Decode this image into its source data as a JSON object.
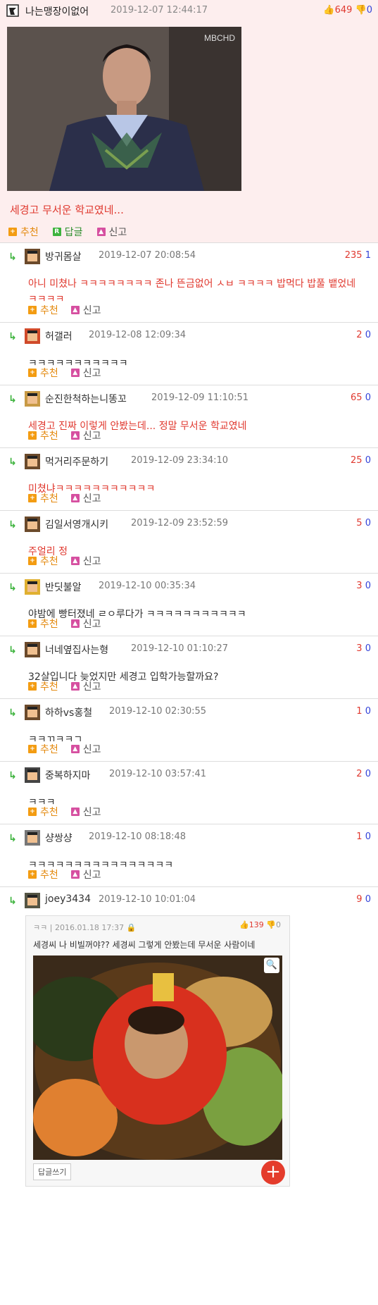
{
  "post": {
    "nick": "나는맹장이없어",
    "date": "2019-12-07 12:44:17",
    "up": "649",
    "down": "0",
    "title": "세경고 무서운 학교였네...",
    "image_overlay": "MBCHD",
    "actions": {
      "recommend": "추천",
      "reply": "답글",
      "report": "신고"
    }
  },
  "comments": [
    {
      "nick": "방귀몸살",
      "date": "2019-12-07 20:08:54",
      "up": "235",
      "down": "1",
      "text": "아니 미쳤나 ㅋㅋㅋㅋㅋㅋㅋㅋ 존나 뜬금없어 ㅅㅂ ㅋㅋㅋㅋ 밥먹다 밥풀 뱉었네 ㅋㅋㅋㅋ",
      "red": true
    },
    {
      "nick": "허갤러",
      "date": "2019-12-08 12:09:34",
      "up": "2",
      "down": "0",
      "text": "ㅋㅋㅋㅋㅋㅋㅋㅋㅋㅋㅋ",
      "red": false
    },
    {
      "nick": "순진한척하는니똥꼬",
      "date": "2019-12-09 11:10:51",
      "up": "65",
      "down": "0",
      "text": "세경고 진짜 이렇게 안봤는데... 정말 무서운 학교였네",
      "red": true
    },
    {
      "nick": "먹거리주문하기",
      "date": "2019-12-09 23:34:10",
      "up": "25",
      "down": "0",
      "text": "미쳤냐ㅋㅋㅋㅋㅋㅋㅋㅋㅋㅋㅋ",
      "red": true
    },
    {
      "nick": "김일서영개시키",
      "date": "2019-12-09 23:52:59",
      "up": "5",
      "down": "0",
      "text": "주얼리 정",
      "red": true
    },
    {
      "nick": "반딧불알",
      "date": "2019-12-10 00:35:34",
      "up": "3",
      "down": "0",
      "text": "야밤에 빵터졌네 ㄹㅇ루다가 ㅋㅋㅋㅋㅋㅋㅋㅋㅋㅋㅋ",
      "red": false
    },
    {
      "nick": "너네옆집사는형",
      "date": "2019-12-10 01:10:27",
      "up": "3",
      "down": "0",
      "text": "32살입니다 늦었지만 세경고 입학가능할까요?",
      "red": false
    },
    {
      "nick": "하하vs홍철",
      "date": "2019-12-10 02:30:55",
      "up": "1",
      "down": "0",
      "text": "ㅋㅋㄲㅋㅋㄱ",
      "red": false
    },
    {
      "nick": "중복하지마",
      "date": "2019-12-10 03:57:41",
      "up": "2",
      "down": "0",
      "text": "ㅋㅋㅋ",
      "red": false
    },
    {
      "nick": "샹쌍샹",
      "date": "2019-12-10 08:18:48",
      "up": "1",
      "down": "0",
      "text": "ㅋㅋㅋㅋㅋㅋㅋㅋㅋㅋㅋㅋㅋㅋㅋㅋ",
      "red": false
    },
    {
      "nick": "joey3434",
      "date": "2019-12-10 10:01:04",
      "up": "9",
      "down": "0",
      "text": "",
      "red": false
    }
  ],
  "quote": {
    "nick": "ㅋㅋ",
    "date": "2016.01.18 17:37",
    "up": "139",
    "down": "0",
    "title": "세경씨 나 비빌꺼야?? 세경씨 그렇게 안봤는데 무서운 사람이네",
    "button": "답글쓰기"
  },
  "colors": {
    "accent_red": "#e0392f",
    "accent_blue": "#3343d9",
    "post_bg": "#fdeeee"
  }
}
